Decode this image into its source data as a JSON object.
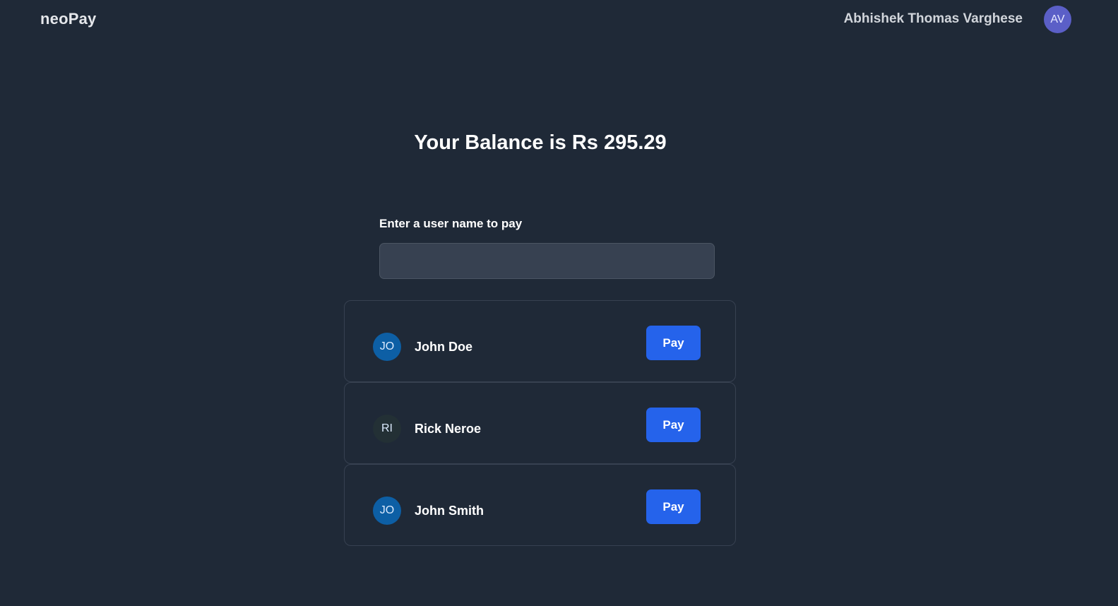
{
  "navbar": {
    "brand": "neoPay",
    "user_name": "Abhishek Thomas Varghese",
    "avatar_initials": "AV"
  },
  "main": {
    "balance_text": "Your Balance is Rs 295.29",
    "search": {
      "label": "Enter a user name to pay",
      "value": "",
      "placeholder": ""
    },
    "users": [
      {
        "initials": "JO",
        "name": "John Doe",
        "avatar_color": "#0d5fa5",
        "pay_label": "Pay"
      },
      {
        "initials": "RI",
        "name": "Rick Neroe",
        "avatar_color": "#233035",
        "pay_label": "Pay"
      },
      {
        "initials": "JO",
        "name": "John Smith",
        "avatar_color": "#0d5fa5",
        "pay_label": "Pay"
      }
    ]
  },
  "colors": {
    "background": "#1f2937",
    "accent": "#2563eb",
    "input_bg": "#374151",
    "user_avatar": "#5b5fc7"
  }
}
